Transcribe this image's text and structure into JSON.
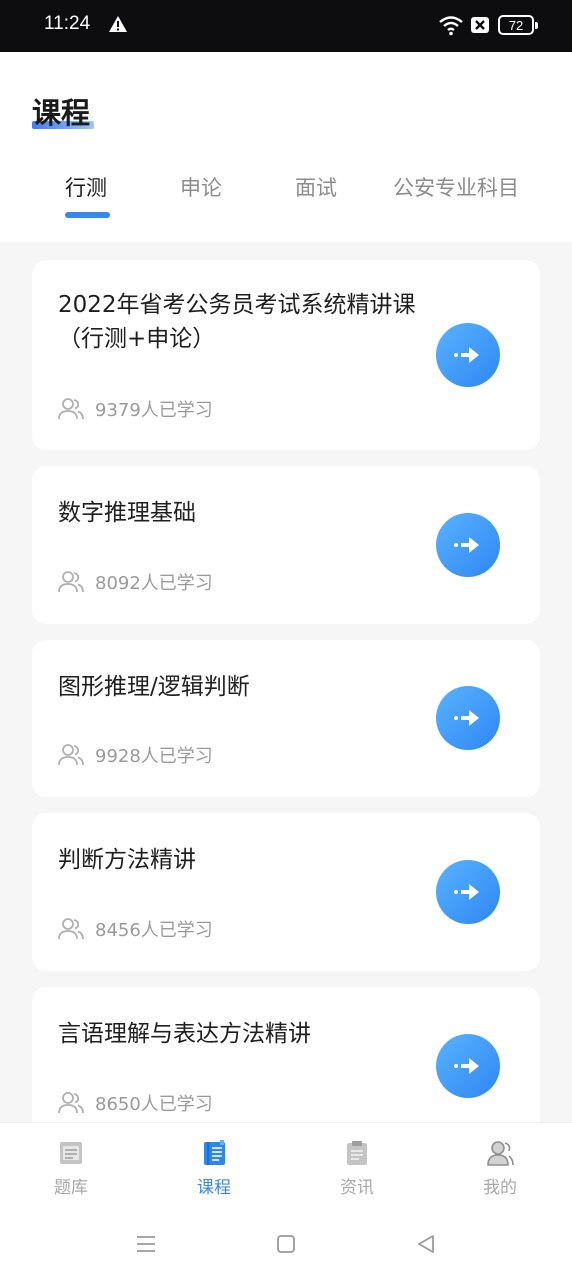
{
  "status_bar": {
    "time": "11:24",
    "battery": "72",
    "icons": [
      "alert-icon",
      "wifi-icon",
      "no-sim-icon",
      "battery-icon"
    ]
  },
  "header": {
    "title": "课程"
  },
  "tabs": [
    {
      "label": "行测",
      "active": true
    },
    {
      "label": "申论",
      "active": false
    },
    {
      "label": "面试",
      "active": false
    },
    {
      "label": "公安专业科目",
      "active": false
    }
  ],
  "courses": [
    {
      "title": "2022年省考公务员考试系统精讲课（行测+申论）",
      "learners": "9379人已学习"
    },
    {
      "title": "数字推理基础",
      "learners": "8092人已学习"
    },
    {
      "title": "图形推理/逻辑判断",
      "learners": "9928人已学习"
    },
    {
      "title": "判断方法精讲",
      "learners": "8456人已学习"
    },
    {
      "title": "言语理解与表达方法精讲",
      "learners": "8650人已学习"
    }
  ],
  "bottom_nav": [
    {
      "label": "题库",
      "icon": "question-bank-icon",
      "active": false
    },
    {
      "label": "课程",
      "icon": "course-icon",
      "active": true
    },
    {
      "label": "资讯",
      "icon": "news-icon",
      "active": false
    },
    {
      "label": "我的",
      "icon": "profile-icon",
      "active": false
    }
  ],
  "colors": {
    "accent": "#3a87f3",
    "button_gradient_start": "#59b3ff",
    "button_gradient_end": "#2f86f3",
    "inactive": "#a8a8a8"
  }
}
